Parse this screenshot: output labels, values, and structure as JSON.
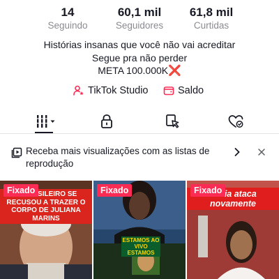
{
  "stats": [
    {
      "value": "14",
      "label": "Seguindo"
    },
    {
      "value": "60,1 mil",
      "label": "Seguidores"
    },
    {
      "value": "61,8 mil",
      "label": "Curtidas"
    }
  ],
  "bio": {
    "line1": "Histórias insanas que você não vai acreditar",
    "line2": "Segue pra não perder",
    "line3": "META 100.000K",
    "line3_emoji": "❌"
  },
  "links": {
    "studio": "TikTok Studio",
    "balance": "Saldo"
  },
  "tabs": {
    "icons": [
      "grid-icon",
      "lock-icon",
      "tag-icon",
      "liked-heart-icon"
    ]
  },
  "banner": {
    "text": "Receba mais visualizações com as listas de reprodução"
  },
  "videos": [
    {
      "badge": "Fixado",
      "caption": "O BRASILEIRO SE RECUSOU A TRAZER O CORPO DE JULIANA MARINS"
    },
    {
      "badge": "Fixado",
      "caption": "ESTAMOS AO VIVO ESTAMOS"
    },
    {
      "badge": "Fixado",
      "caption": "ância ataca novamente"
    }
  ],
  "colors": {
    "accent": "#fe2c55",
    "text": "#161823",
    "muted": "#8a8b91"
  }
}
